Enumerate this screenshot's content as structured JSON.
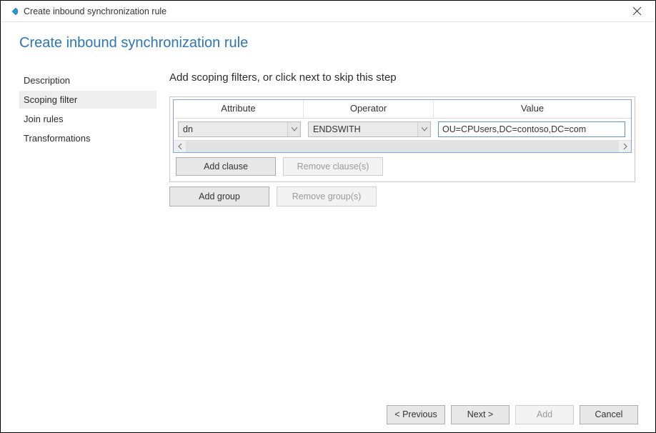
{
  "titlebar": {
    "title": "Create inbound synchronization rule"
  },
  "page": {
    "heading": "Create inbound synchronization rule"
  },
  "sidebar": {
    "items": [
      {
        "label": "Description",
        "selected": false
      },
      {
        "label": "Scoping filter",
        "selected": true
      },
      {
        "label": "Join rules",
        "selected": false
      },
      {
        "label": "Transformations",
        "selected": false
      }
    ]
  },
  "main": {
    "step_heading": "Add scoping filters, or click next to skip this step",
    "columns": {
      "attribute": "Attribute",
      "operator": "Operator",
      "value": "Value"
    },
    "clause": {
      "attribute": "dn",
      "operator": "ENDSWITH",
      "value": "OU=CPUsers,DC=contoso,DC=com"
    },
    "buttons": {
      "add_clause": "Add clause",
      "remove_clause": "Remove clause(s)",
      "add_group": "Add group",
      "remove_group": "Remove group(s)"
    }
  },
  "footer": {
    "previous": "< Previous",
    "next": "Next >",
    "add": "Add",
    "cancel": "Cancel"
  }
}
